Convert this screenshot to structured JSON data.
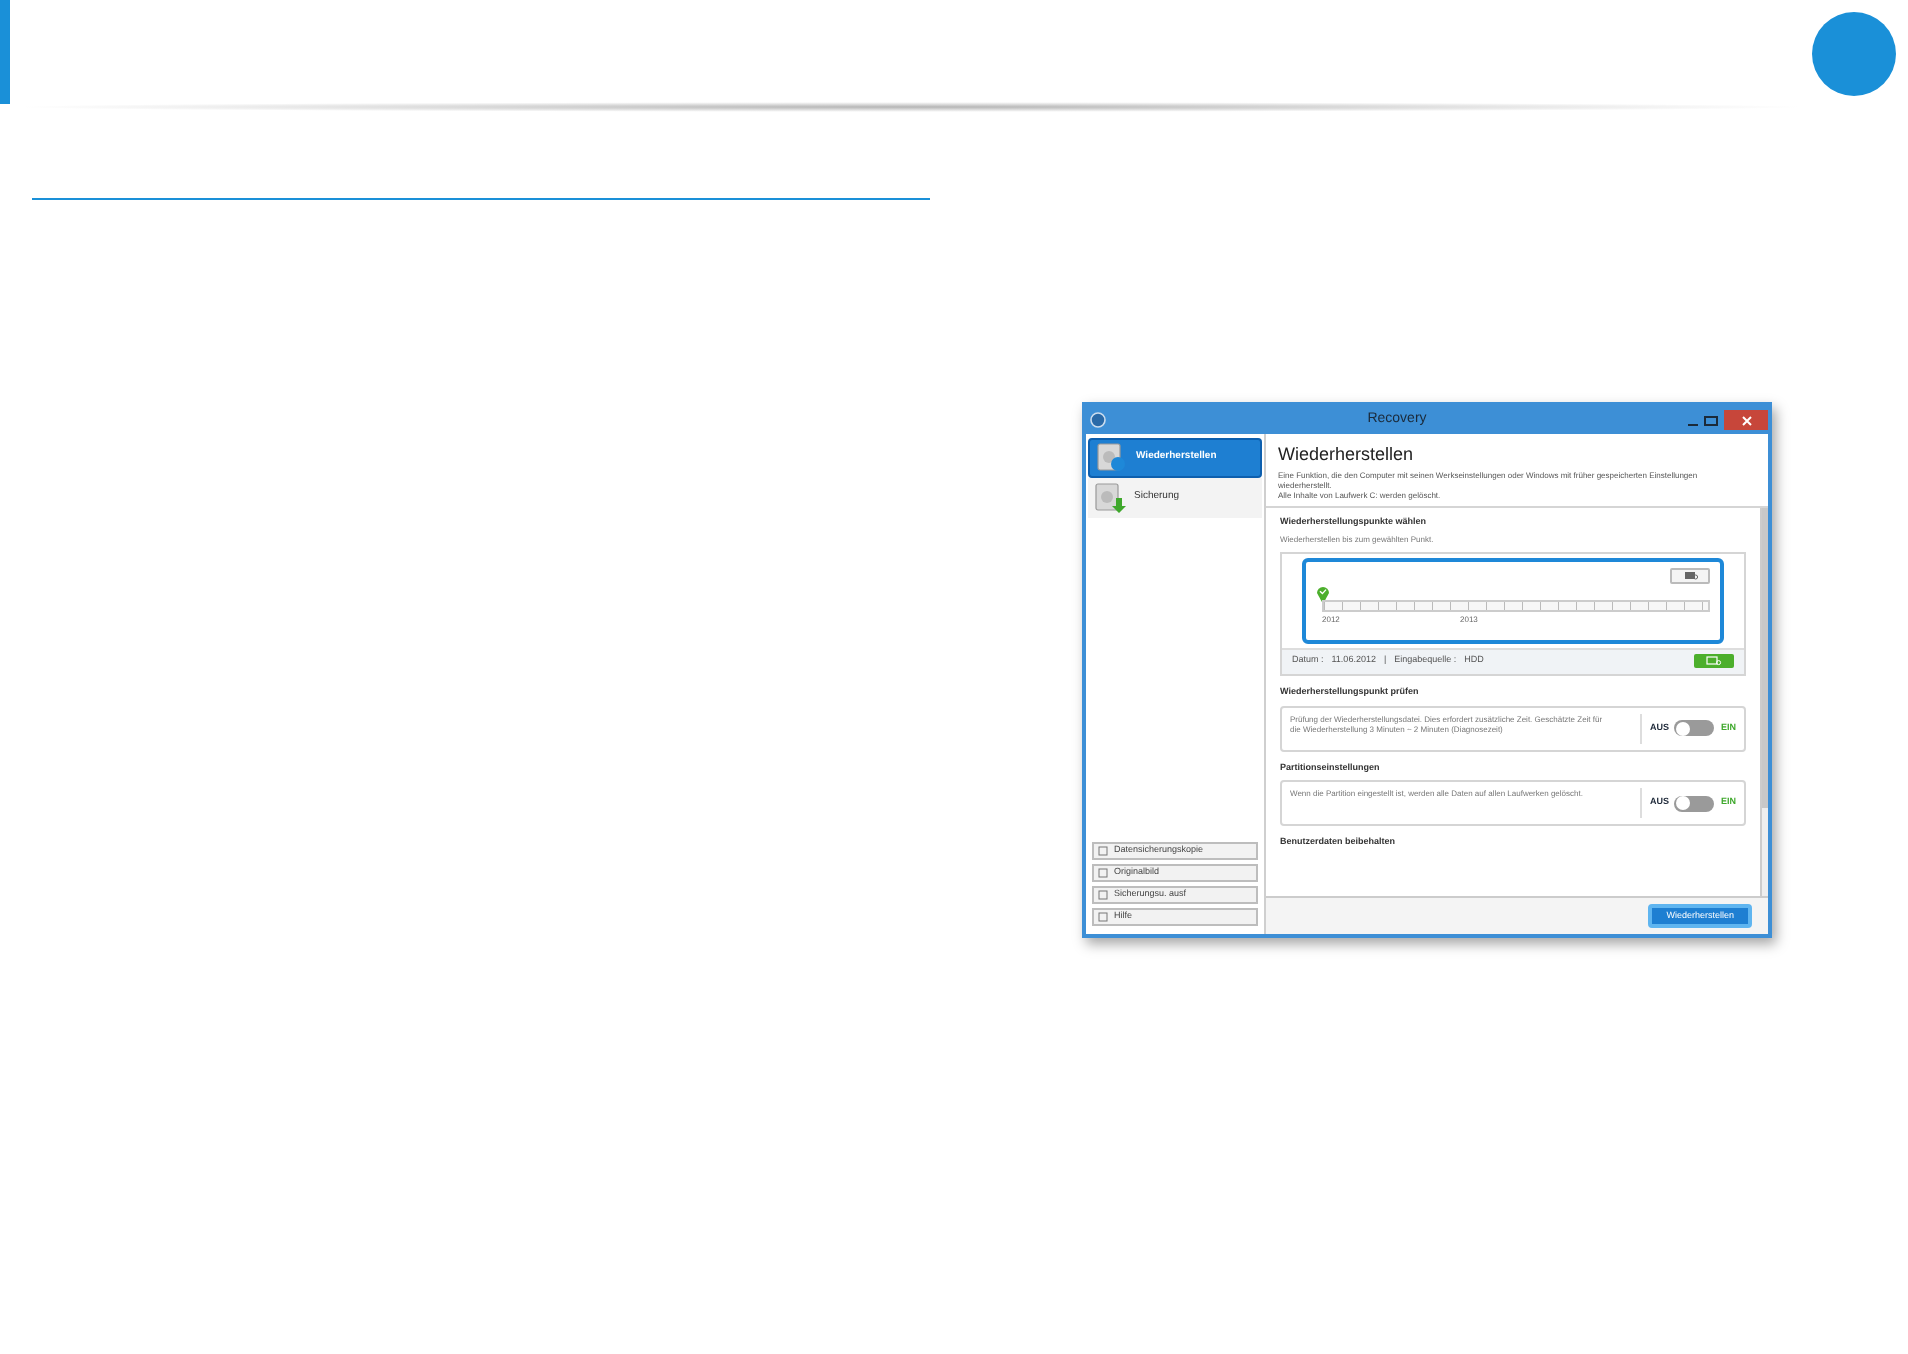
{
  "window": {
    "title": "Recovery"
  },
  "sidebar": {
    "items": [
      {
        "label": "Wiederherstellen",
        "selected": true
      },
      {
        "label": "Sicherung",
        "selected": false
      }
    ],
    "buttons": [
      "Datensicherungskopie",
      "Originalbild",
      "Sicherungsu. ausf",
      "Hilfe"
    ]
  },
  "content": {
    "heading": "Wiederherstellen",
    "description": [
      "Eine Funktion, die den Computer mit seinen Werkseinstellungen oder Windows mit früher gespeicherten Einstellungen wiederherstellt.",
      "Alle Inhalte von Laufwerk C: werden gelöscht."
    ],
    "restore_points": {
      "title": "Wiederherstellungspunkte wählen",
      "hint": "Wiederherstellen bis zum gewählten Punkt.",
      "timeline_labels": [
        "2012",
        "2013"
      ],
      "date_label": "Datum :",
      "date": "11.06.2012",
      "separator": "|",
      "source_label": "Eingabequelle :",
      "source": "HDD"
    },
    "sections": [
      {
        "title": "Wiederherstellungspunkt prüfen",
        "text": "Prüfung der Wiederherstellungsdatei. Dies erfordert zusätzliche Zeit. Geschätzte Zeit für die Wiederherstellung 3 Minuten ~ 2 Minuten (Diagnosezeit)",
        "off_label": "AUS",
        "on_label": "EIN",
        "on": false
      },
      {
        "title": "Partitionseinstellungen",
        "text": "Wenn die Partition eingestellt ist, werden alle Daten auf allen Laufwerken gelöscht.",
        "off_label": "AUS",
        "on_label": "EIN",
        "on": false
      }
    ],
    "cut_section": "Benutzerdaten beibehalten",
    "action_button": "Wiederherstellen"
  }
}
